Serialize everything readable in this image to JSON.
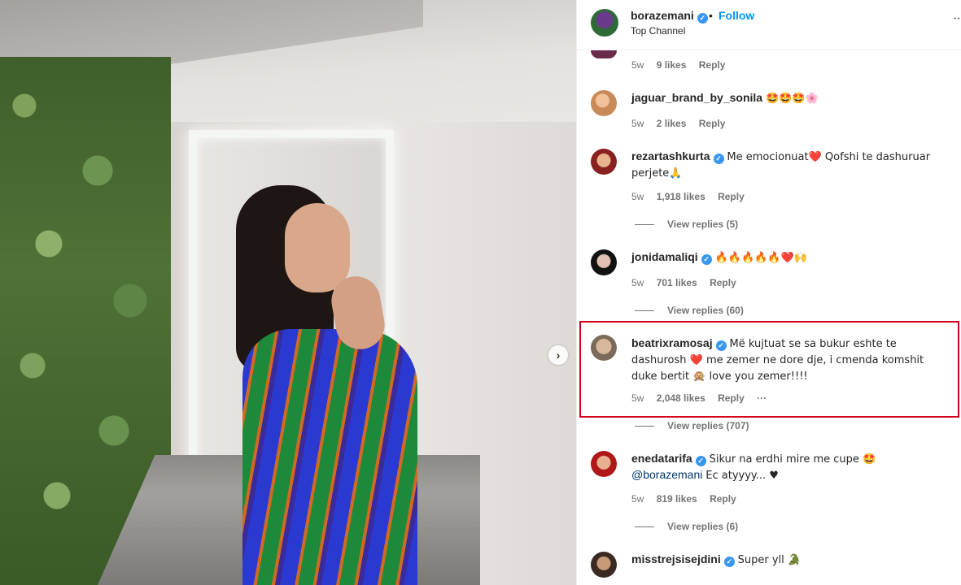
{
  "header": {
    "username": "borazemani",
    "follow_label": "Follow",
    "subtitle": "Top Channel",
    "separator": "•",
    "more_label": "···"
  },
  "carousel": {
    "next_icon": "chevron-right-icon",
    "next_label": "›"
  },
  "colors": {
    "accent": "#0095f6",
    "verified": "#3897f0",
    "highlight": "#d0021b"
  },
  "comments": [
    {
      "username": "",
      "text": "",
      "time": "5w",
      "likes": "9 likes",
      "reply": "Reply"
    },
    {
      "username": "jaguar_brand_by_sonila",
      "verified": false,
      "text": "🤩🤩🤩🌸",
      "time": "5w",
      "likes": "2 likes",
      "reply": "Reply"
    },
    {
      "username": "rezartashkurta",
      "verified": true,
      "text": "Me emocionuat❤️ Qofshi te dashuruar perjete🙏",
      "time": "5w",
      "likes": "1,918 likes",
      "reply": "Reply",
      "view_replies": "View replies (5)"
    },
    {
      "username": "jonidamaliqi",
      "verified": true,
      "text": "🔥🔥🔥🔥🔥❤️🙌",
      "time": "5w",
      "likes": "701 likes",
      "reply": "Reply",
      "view_replies": "View replies (60)"
    },
    {
      "username": "beatrixramosaj",
      "verified": true,
      "text": "Më kujtuat se sa bukur eshte te dashurosh ❤️ me zemer ne dore dje, i cmenda komshit duke bertit 🙊 love you zemer!!!!",
      "time": "5w",
      "likes": "2,048 likes",
      "reply": "Reply",
      "more": "···",
      "view_replies": "View replies (707)"
    },
    {
      "username": "enedatarifa",
      "verified": true,
      "text": "Sikur na erdhi mire me cupe 🤩",
      "mention": "@borazemani",
      "text2": "Ec atyyyy... ♥",
      "time": "5w",
      "likes": "819 likes",
      "reply": "Reply",
      "view_replies": "View replies (6)"
    },
    {
      "username": "misstrejsisejdini",
      "verified": true,
      "text": "Super yll 🐊"
    }
  ]
}
